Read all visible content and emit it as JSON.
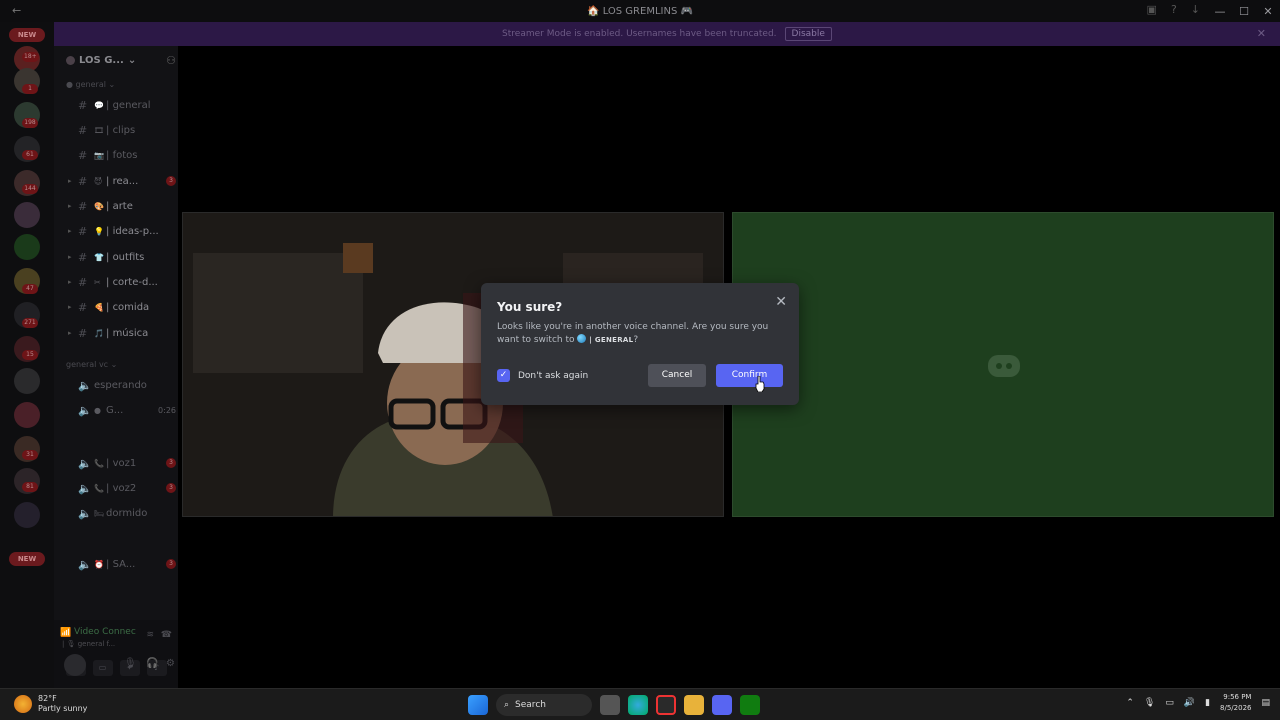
{
  "window": {
    "title": "LOS GREMLINS"
  },
  "banner": {
    "text": "Streamer Mode is enabled. Usernames have been truncated.",
    "disable_label": "Disable"
  },
  "server": {
    "name": "LOS G...",
    "top_category": "general"
  },
  "rail": {
    "new_top": "NEW",
    "new_bottom": "NEW",
    "badges": [
      "18+",
      "1",
      "198",
      "61",
      "144",
      "15",
      "31",
      "81",
      "271",
      "47"
    ]
  },
  "channels": [
    {
      "name": "general",
      "emoji": "💬",
      "bright": false
    },
    {
      "name": "clips",
      "emoji": "🎞",
      "bright": false
    },
    {
      "name": "fotos",
      "emoji": "📷",
      "bright": false
    },
    {
      "name": "rea...",
      "emoji": "😈",
      "bright": true,
      "badge": "3"
    },
    {
      "name": "arte",
      "emoji": "🎨",
      "bright": true
    },
    {
      "name": "ideas-p...",
      "emoji": "💡",
      "bright": true
    },
    {
      "name": "outfits",
      "emoji": "👕",
      "bright": true
    },
    {
      "name": "corte-d...",
      "emoji": "✂",
      "bright": true
    },
    {
      "name": "comida",
      "emoji": "🍕",
      "bright": true
    },
    {
      "name": "música",
      "emoji": "🎵",
      "bright": true
    }
  ],
  "voice_category": "general vc",
  "voice_channels": [
    {
      "name": "esperando"
    },
    {
      "name": "G...",
      "time": "0:26"
    },
    {
      "name": "voz1",
      "badge": "3"
    },
    {
      "name": "voz2",
      "badge": "3"
    },
    {
      "name": "dormido"
    },
    {
      "name": "SA...",
      "badge": "3"
    }
  ],
  "voice_status": {
    "title": "Video Connec",
    "sub": "| 🎙 general f..."
  },
  "modal": {
    "title": "You sure?",
    "body": "Looks like you're in another voice channel. Are you sure you want to switch to",
    "channel": "| GENERAL",
    "suffix": "?",
    "checkbox_label": "Don't ask again",
    "checkbox_checked": true,
    "cancel_label": "Cancel",
    "confirm_label": "Confirm"
  },
  "taskbar": {
    "weather_temp": "82°F",
    "weather_desc": "Partly sunny",
    "search_label": "Search",
    "time": "9:56 PM",
    "date": "8/5/2026"
  },
  "colors": {
    "accent": "#5865f2",
    "banner": "#2c1846",
    "green_tile": "#1e3f1e",
    "modal_bg": "#313338"
  }
}
